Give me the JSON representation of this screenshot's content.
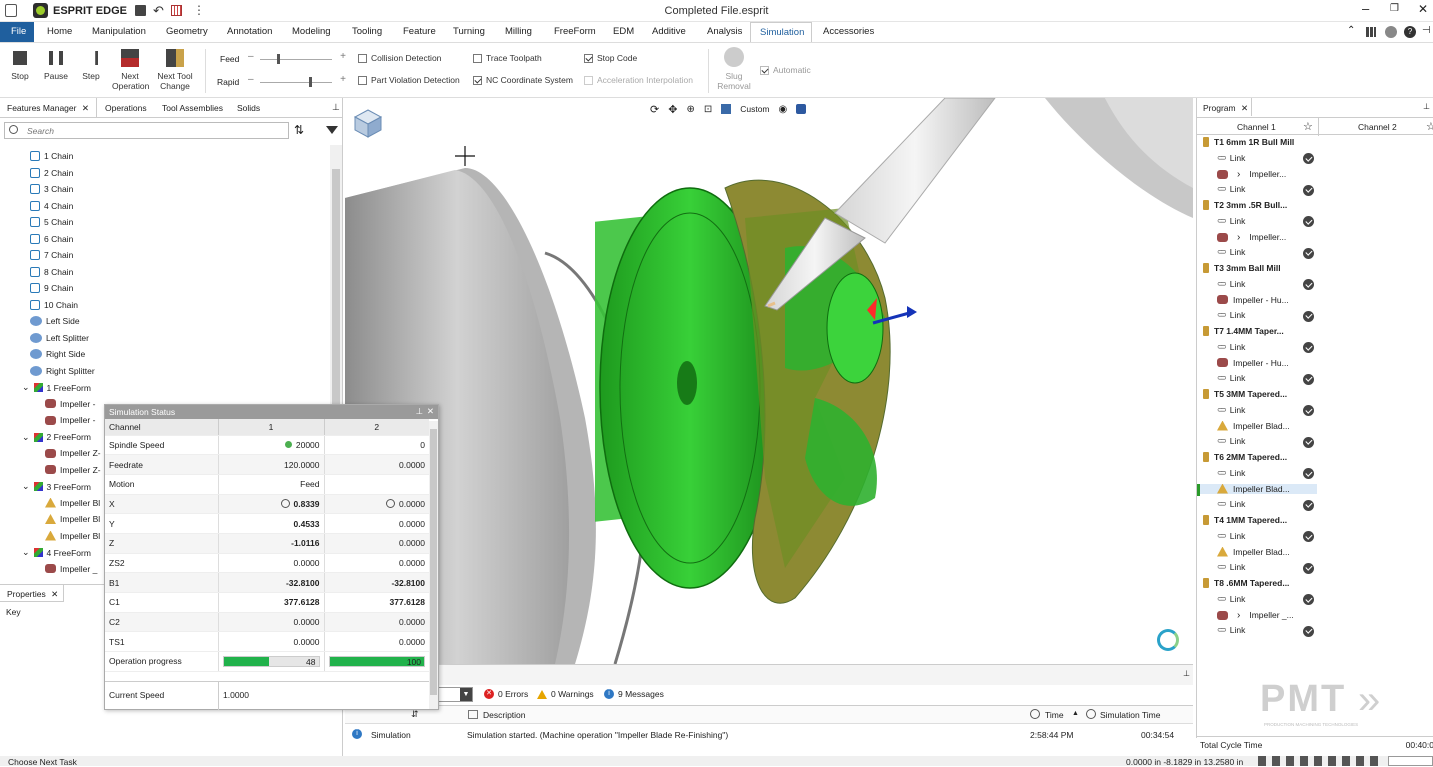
{
  "app": {
    "name": "ESPRIT EDGE",
    "file_title": "Completed File.esprit"
  },
  "menu": [
    "File",
    "Home",
    "Manipulation",
    "Geometry",
    "Annotation",
    "Modeling",
    "Tooling",
    "Feature",
    "Turning",
    "Milling",
    "FreeForm",
    "EDM",
    "Additive",
    "Analysis",
    "Simulation",
    "Accessories"
  ],
  "menu_active": "Simulation",
  "ribbon": {
    "stop": "Stop",
    "pause": "Pause",
    "step": "Step",
    "next_operation": [
      "Next",
      "Operation"
    ],
    "next_tool_change": [
      "Next Tool",
      "Change"
    ],
    "feed": "Feed",
    "rapid": "Rapid",
    "collision_detection": "Collision Detection",
    "part_violation": "Part Violation Detection",
    "trace_toolpath": "Trace Toolpath",
    "nc_coordinate": "NC Coordinate System",
    "stop_code": "Stop Code",
    "accel_interp": "Acceleration Interpolation",
    "slug_removal": [
      "Slug",
      "Removal"
    ],
    "automatic": "Automatic"
  },
  "left_tabs": [
    "Features Manager",
    "Operations",
    "Tool Assemblies",
    "Solids"
  ],
  "search_placeholder": "Search",
  "tree": [
    {
      "label": "1 Chain",
      "icon": "chain"
    },
    {
      "label": "2 Chain",
      "icon": "chain"
    },
    {
      "label": "3 Chain",
      "icon": "chain"
    },
    {
      "label": "4 Chain",
      "icon": "chain"
    },
    {
      "label": "5 Chain",
      "icon": "chain"
    },
    {
      "label": "6 Chain",
      "icon": "chain"
    },
    {
      "label": "7 Chain",
      "icon": "chain"
    },
    {
      "label": "8 Chain",
      "icon": "chain"
    },
    {
      "label": "9 Chain",
      "icon": "chain"
    },
    {
      "label": "10 Chain",
      "icon": "chain"
    },
    {
      "label": "Left Side",
      "icon": "surface"
    },
    {
      "label": "Left Splitter",
      "icon": "surface"
    },
    {
      "label": "Right Side",
      "icon": "surface"
    },
    {
      "label": "Right Splitter",
      "icon": "surface"
    },
    {
      "label": "1 FreeForm",
      "icon": "freeform"
    },
    {
      "label": "Impeller -",
      "icon": "op"
    },
    {
      "label": "Impeller -",
      "icon": "op"
    },
    {
      "label": "2 FreeForm",
      "icon": "freeform"
    },
    {
      "label": "Impeller Z-",
      "icon": "op"
    },
    {
      "label": "Impeller Z-",
      "icon": "op"
    },
    {
      "label": "3 FreeForm",
      "icon": "freeform"
    },
    {
      "label": "Impeller Bl",
      "icon": "op2"
    },
    {
      "label": "Impeller Bl",
      "icon": "op2"
    },
    {
      "label": "Impeller Bl",
      "icon": "op2"
    },
    {
      "label": "4 FreeForm",
      "icon": "freeform"
    },
    {
      "label": "Impeller _",
      "icon": "op"
    }
  ],
  "properties": {
    "tab": "Properties",
    "key": "Key"
  },
  "view_toolbar": {
    "custom": "Custom"
  },
  "simulation_status": {
    "title": "Simulation Status",
    "headers": [
      "Channel",
      "1",
      "2"
    ],
    "rows": [
      [
        "Spindle Speed",
        "20000",
        "0"
      ],
      [
        "Feedrate",
        "120.0000",
        "0.0000"
      ],
      [
        "Motion",
        "Feed",
        ""
      ],
      [
        "X",
        "0.8339",
        "0.0000"
      ],
      [
        "Y",
        "0.4533",
        "0.0000"
      ],
      [
        "Z",
        "-1.0116",
        "0.0000"
      ],
      [
        "ZS2",
        "0.0000",
        "0.0000"
      ],
      [
        "B1",
        "-32.8100",
        "-32.8100"
      ],
      [
        "C1",
        "377.6128",
        "377.6128"
      ],
      [
        "C2",
        "0.0000",
        "0.0000"
      ],
      [
        "TS1",
        "0.0000",
        "0.0000"
      ]
    ],
    "progress_label": "Operation progress",
    "progress": [
      48,
      100
    ],
    "current_speed_label": "Current Speed",
    "current_speed": "1.0000"
  },
  "messages": {
    "errors": "0 Errors",
    "warnings": "0 Warnings",
    "messages": "9 Messages",
    "col_description": "Description",
    "col_time": "Time",
    "col_sim_time": "Simulation Time",
    "row": {
      "type": "Simulation",
      "desc": "Simulation started. (Machine operation \"Impeller Blade Re-Finishing\")",
      "time": "2:58:44 PM",
      "sim_time": "00:34:54"
    }
  },
  "program": {
    "tab": "Program",
    "channels": [
      "Channel 1",
      "Channel 2"
    ],
    "items": [
      {
        "label": "T1 6mm 1R Bull Mill",
        "kind": "tool"
      },
      {
        "label": "Link",
        "kind": "link"
      },
      {
        "label": "Impeller...",
        "kind": "op",
        "arrow": true
      },
      {
        "label": "Link",
        "kind": "link"
      },
      {
        "label": "T2 3mm .5R Bull...",
        "kind": "tool"
      },
      {
        "label": "Link",
        "kind": "link"
      },
      {
        "label": "Impeller...",
        "kind": "op",
        "arrow": true
      },
      {
        "label": "Link",
        "kind": "link"
      },
      {
        "label": "T3 3mm Ball Mill",
        "kind": "tool"
      },
      {
        "label": "Link",
        "kind": "link"
      },
      {
        "label": "Impeller - Hu...",
        "kind": "op"
      },
      {
        "label": "Link",
        "kind": "link"
      },
      {
        "label": "T7 1.4MM Taper...",
        "kind": "tool"
      },
      {
        "label": "Link",
        "kind": "link"
      },
      {
        "label": "Impeller - Hu...",
        "kind": "op"
      },
      {
        "label": "Link",
        "kind": "link"
      },
      {
        "label": "T5 3MM Tapered...",
        "kind": "tool"
      },
      {
        "label": "Link",
        "kind": "link"
      },
      {
        "label": "Impeller Blad...",
        "kind": "op2"
      },
      {
        "label": "Link",
        "kind": "link"
      },
      {
        "label": "T6 2MM Tapered...",
        "kind": "tool"
      },
      {
        "label": "Link",
        "kind": "link"
      },
      {
        "label": "Impeller Blad...",
        "kind": "op2",
        "selected": true
      },
      {
        "label": "Link",
        "kind": "link"
      },
      {
        "label": "T4 1MM Tapered...",
        "kind": "tool"
      },
      {
        "label": "Link",
        "kind": "link"
      },
      {
        "label": "Impeller Blad...",
        "kind": "op2"
      },
      {
        "label": "Link",
        "kind": "link"
      },
      {
        "label": "T8 .6MM Tapered...",
        "kind": "tool"
      },
      {
        "label": "Link",
        "kind": "link"
      },
      {
        "label": "Impeller _...",
        "kind": "op",
        "arrow": true
      },
      {
        "label": "Link",
        "kind": "link"
      }
    ],
    "total_cycle_label": "Total Cycle Time",
    "total_cycle_value": "00:40:0"
  },
  "watermark": {
    "big": "PMT",
    "small": "PRODUCTION MACHINING TECHNOLOGIES"
  },
  "status": {
    "left": "Choose Next Task",
    "coords": "0.0000 in  -8.1829 in  13.2580 in"
  }
}
